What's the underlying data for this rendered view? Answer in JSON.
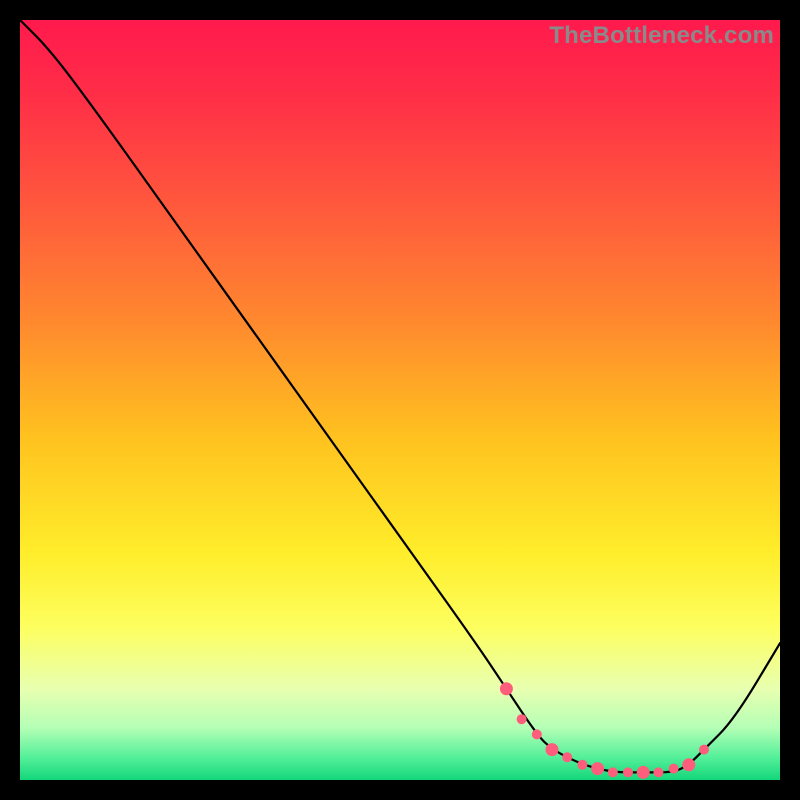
{
  "watermark": "TheBottleneck.com",
  "chart_data": {
    "type": "line",
    "title": "",
    "xlabel": "",
    "ylabel": "",
    "xlim": [
      0,
      100
    ],
    "ylim": [
      0,
      100
    ],
    "grid": false,
    "legend": false,
    "series": [
      {
        "name": "curve",
        "x": [
          0,
          4,
          10,
          20,
          30,
          40,
          50,
          60,
          64,
          68,
          70,
          74,
          78,
          82,
          86,
          88,
          90,
          94,
          100
        ],
        "y": [
          100,
          96,
          88,
          74,
          60,
          46,
          32,
          18,
          12,
          6,
          4,
          2,
          1,
          1,
          1,
          2,
          4,
          8,
          18
        ]
      }
    ],
    "trough_markers_x": [
      64,
      66,
      68,
      70,
      72,
      74,
      76,
      78,
      80,
      82,
      84,
      86,
      88,
      90
    ],
    "trough_markers_y": [
      12,
      8,
      6,
      4,
      3,
      2,
      1.5,
      1,
      1,
      1,
      1,
      1.5,
      2,
      4
    ],
    "gradient_stops": [
      {
        "offset": 0.0,
        "color": "#ff1a4d"
      },
      {
        "offset": 0.1,
        "color": "#ff2e47"
      },
      {
        "offset": 0.25,
        "color": "#ff5a3c"
      },
      {
        "offset": 0.4,
        "color": "#ff8a2e"
      },
      {
        "offset": 0.55,
        "color": "#ffc21f"
      },
      {
        "offset": 0.7,
        "color": "#ffed2a"
      },
      {
        "offset": 0.8,
        "color": "#fdff60"
      },
      {
        "offset": 0.88,
        "color": "#e8ffb0"
      },
      {
        "offset": 0.93,
        "color": "#b6ffb6"
      },
      {
        "offset": 0.97,
        "color": "#55f09a"
      },
      {
        "offset": 1.0,
        "color": "#14d67a"
      }
    ],
    "marker_color": "#ff5d7c",
    "curve_color": "#000000"
  }
}
